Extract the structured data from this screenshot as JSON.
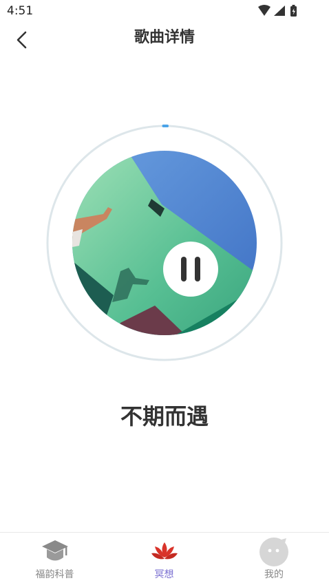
{
  "status_bar": {
    "time": "4:51"
  },
  "header": {
    "title": "歌曲详情",
    "back_icon": "chevron-left-icon"
  },
  "player": {
    "song_title": "不期而遇",
    "state": "playing",
    "progress": 0.01,
    "accent": "#4aa3e8"
  },
  "tab_bar": {
    "items": [
      {
        "label": "福韵科普",
        "icon": "graduation-cap-icon",
        "active": false
      },
      {
        "label": "冥想",
        "icon": "lotus-icon",
        "active": true
      },
      {
        "label": "我的",
        "icon": "avatar-icon",
        "active": false
      }
    ],
    "active_color": "#7a6fd1",
    "inactive_color": "#888888"
  }
}
